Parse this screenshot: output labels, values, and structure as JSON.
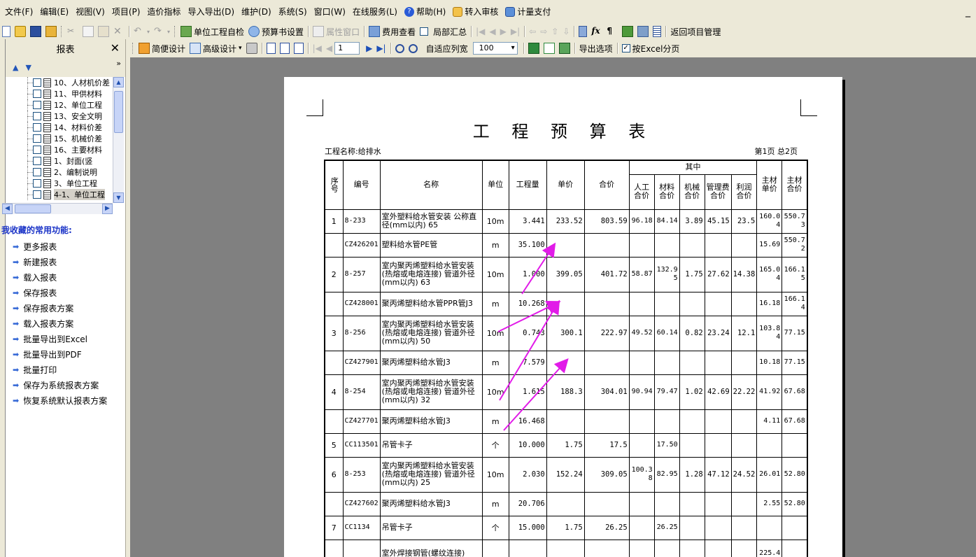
{
  "menu": {
    "items": [
      "文件(F)",
      "编辑(E)",
      "视图(V)",
      "项目(P)",
      "造价指标",
      "导入导出(D)",
      "维护(D)",
      "系统(S)",
      "窗口(W)",
      "在线服务(L)"
    ],
    "help": "帮助(H)",
    "audit": "转入审核",
    "pay": "计量支付",
    "window_control": "_"
  },
  "toolbar1": {
    "self_check": "单位工程自检",
    "budget_settings": "预算书设置",
    "property_window": "属性窗口",
    "fee_view": "费用查看",
    "partial_summary": "局部汇总",
    "return_project": "返回项目管理"
  },
  "toolbar2": {
    "simple_design": "简便设计",
    "advanced_design": "高级设计",
    "page_value": "1",
    "fit_width": "自适应列宽",
    "zoom_value": "100",
    "export_options": "导出选项",
    "excel_paging": "按Excel分页"
  },
  "left_panel": {
    "title": "报表",
    "close": "✕",
    "more": "»",
    "tree": [
      "10、人材机价差",
      "11、甲供材料",
      "12、单位工程",
      "13、安全文明",
      "14、材料价差",
      "15、机械价差",
      "16、主要材料",
      "1、封面(竖",
      "2、编制说明",
      "3、单位工程",
      "4-1、单位工程"
    ],
    "favorites_title": "我收藏的常用功能:",
    "favorites": [
      "更多报表",
      "新建报表",
      "载入报表",
      "保存报表",
      "保存报表方案",
      "载入报表方案",
      "批量导出到Excel",
      "批量导出到PDF",
      "批量打印",
      "保存为系统报表方案",
      "恢复系统默认报表方案"
    ]
  },
  "report": {
    "title": "工 程 预 算 表",
    "project_name": "工程名称:给排水",
    "page_info": "第1页  总2页",
    "headers": {
      "seq": "序号",
      "code": "编号",
      "name": "名称",
      "unit": "单位",
      "qty": "工程量",
      "price": "单价",
      "total": "合价",
      "among": "其中",
      "labor": "人工合价",
      "material": "材料合价",
      "machine": "机械合价",
      "mgmt": "管理费合价",
      "profit": "利润合价",
      "main_mat_price": "主材单价",
      "main_mat_total": "主材合价"
    },
    "rows": [
      {
        "seq": "1",
        "code": "8-233",
        "name": "室外塑料给水管安装 公称直径(mm以内) 65",
        "unit": "10m",
        "qty": "3.441",
        "price": "233.52",
        "total": "803.59",
        "labor": "96.18",
        "material": "84.14",
        "machine": "3.89",
        "mgmt": "45.15",
        "profit": "23.5",
        "mp": "160.04",
        "mt": "550.73"
      },
      {
        "seq": "",
        "code": "CZ426201",
        "name": "塑料给水管PE管",
        "unit": "m",
        "qty": "35.100",
        "price": "",
        "total": "",
        "labor": "",
        "material": "",
        "machine": "",
        "mgmt": "",
        "profit": "",
        "mp": "15.69",
        "mt": "550.72"
      },
      {
        "seq": "2",
        "code": "8-257",
        "name": "室内聚丙烯塑料给水管安装(热熔或电熔连接) 管道外径(mm以内) 63",
        "unit": "10m",
        "qty": "1.000",
        "price": "399.05",
        "total": "401.72",
        "labor": "58.87",
        "material": "132.95",
        "machine": "1.75",
        "mgmt": "27.62",
        "profit": "14.38",
        "mp": "165.04",
        "mt": "166.15"
      },
      {
        "seq": "",
        "code": "CZ428001",
        "name": "聚丙烯塑料给水管PPR管J3",
        "unit": "m",
        "qty": "10.268",
        "price": "",
        "total": "",
        "labor": "",
        "material": "",
        "machine": "",
        "mgmt": "",
        "profit": "",
        "mp": "16.18",
        "mt": "166.14"
      },
      {
        "seq": "3",
        "code": "8-256",
        "name": "室内聚丙烯塑料给水管安装(热熔或电熔连接) 管道外径(mm以内) 50",
        "unit": "10m",
        "qty": "0.743",
        "price": "300.1",
        "total": "222.97",
        "labor": "49.52",
        "material": "60.14",
        "machine": "0.82",
        "mgmt": "23.24",
        "profit": "12.1",
        "mp": "103.84",
        "mt": "77.15"
      },
      {
        "seq": "",
        "code": "CZ427901",
        "name": "聚丙烯塑料给水管J3",
        "unit": "m",
        "qty": "7.579",
        "price": "",
        "total": "",
        "labor": "",
        "material": "",
        "machine": "",
        "mgmt": "",
        "profit": "",
        "mp": "10.18",
        "mt": "77.15"
      },
      {
        "seq": "4",
        "code": "8-254",
        "name": "室内聚丙烯塑料给水管安装(热熔或电熔连接) 管道外径(mm以内) 32",
        "unit": "10m",
        "qty": "1.615",
        "price": "188.3",
        "total": "304.01",
        "labor": "90.94",
        "material": "79.47",
        "machine": "1.02",
        "mgmt": "42.69",
        "profit": "22.22",
        "mp": "41.92",
        "mt": "67.68"
      },
      {
        "seq": "",
        "code": "CZ427701",
        "name": "聚丙烯塑料给水管J3",
        "unit": "m",
        "qty": "16.468",
        "price": "",
        "total": "",
        "labor": "",
        "material": "",
        "machine": "",
        "mgmt": "",
        "profit": "",
        "mp": "4.11",
        "mt": "67.68"
      },
      {
        "seq": "5",
        "code": "CC113501",
        "name": "吊管卡子",
        "unit": "个",
        "qty": "10.000",
        "price": "1.75",
        "total": "17.5",
        "labor": "",
        "material": "17.50",
        "machine": "",
        "mgmt": "",
        "profit": "",
        "mp": "",
        "mt": ""
      },
      {
        "seq": "6",
        "code": "8-253",
        "name": "室内聚丙烯塑料给水管安装(热熔或电熔连接) 管道外径(mm以内) 25",
        "unit": "10m",
        "qty": "2.030",
        "price": "152.24",
        "total": "309.05",
        "labor": "100.38",
        "material": "82.95",
        "machine": "1.28",
        "mgmt": "47.12",
        "profit": "24.52",
        "mp": "26.01",
        "mt": "52.80"
      },
      {
        "seq": "",
        "code": "CZ427602",
        "name": "聚丙烯塑料给水管J3",
        "unit": "m",
        "qty": "20.706",
        "price": "",
        "total": "",
        "labor": "",
        "material": "",
        "machine": "",
        "mgmt": "",
        "profit": "",
        "mp": "2.55",
        "mt": "52.80"
      },
      {
        "seq": "7",
        "code": "CC1134",
        "name": "吊管卡子",
        "unit": "个",
        "qty": "15.000",
        "price": "1.75",
        "total": "26.25",
        "labor": "",
        "material": "26.25",
        "machine": "",
        "mgmt": "",
        "profit": "",
        "mp": "",
        "mt": ""
      },
      {
        "seq": "",
        "code": "",
        "name": "室外焊接钢管(螺纹连接)",
        "unit": "",
        "qty": "",
        "price": "",
        "total": "",
        "labor": "",
        "material": "",
        "machine": "",
        "mgmt": "",
        "profit": "",
        "mp": "225.4",
        "mt": ""
      }
    ]
  },
  "colors": {
    "chrome": "#ece9d8",
    "preview_bg": "#808080",
    "annotation": "#e11be8",
    "favorites_title": "#1a33c7"
  }
}
